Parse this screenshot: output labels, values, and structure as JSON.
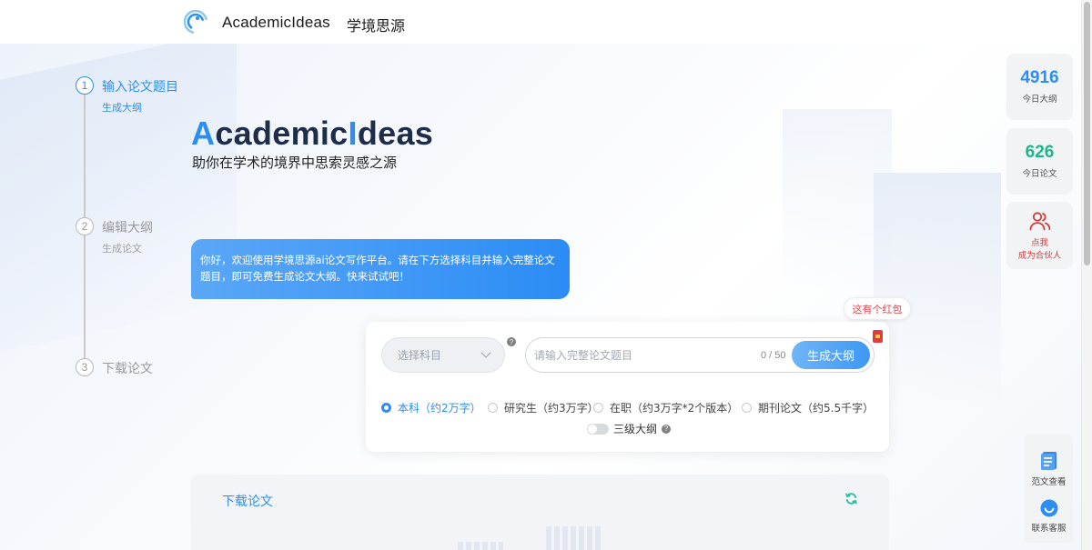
{
  "header": {
    "brand_en": "AcademicIdeas",
    "brand_cn": "学境思源",
    "logo_icon": "academicideas-logo-icon"
  },
  "steps": [
    {
      "number": "1",
      "title": "输入论文题目",
      "sub": "生成大纲",
      "active": true
    },
    {
      "number": "2",
      "title": "编辑大纲",
      "sub": "生成论文",
      "active": false
    },
    {
      "number": "3",
      "title": "下载论文",
      "sub": "",
      "active": false
    }
  ],
  "hero": {
    "title_accent_a": "A",
    "title_mid": "cademic",
    "title_accent_i": "I",
    "title_end": "deas",
    "subtitle": "助你在学术的境界中思索灵感之源"
  },
  "welcome_message": "你好，欢迎使用学境思源ai论文写作平台。请在下方选择科目并输入完整论文题目，即可免费生成论文大纲。快来试试吧！",
  "red_packet": {
    "tip": "这有个红包"
  },
  "form": {
    "subject_placeholder": "选择科目",
    "title_placeholder": "请输入完整论文题目",
    "char_count": "0 / 50",
    "generate_label": "生成大纲",
    "help": "?",
    "radios": [
      {
        "label": "本科（约2万字）",
        "checked": true
      },
      {
        "label": "研究生（约3万字）",
        "checked": false
      },
      {
        "label": "在职（约3万字*2个版本）",
        "checked": false
      },
      {
        "label": "期刊论文（约5.5千字）",
        "checked": false
      }
    ],
    "toggle_label": "三级大纲"
  },
  "download": {
    "title": "下载论文"
  },
  "stats": [
    {
      "value": "4916",
      "label": "今日大纲",
      "color": "#2d8ef0"
    },
    {
      "value": "626",
      "label": "今日论文",
      "color": "#1fb58a"
    }
  ],
  "partner": {
    "line1": "点我",
    "line2": "成为合伙人"
  },
  "tools": [
    {
      "label": "范文查看",
      "icon": "document-icon"
    },
    {
      "label": "联系客服",
      "icon": "customer-service-icon"
    }
  ],
  "colors": {
    "accent": "#2d8ef0",
    "green": "#1fb58a",
    "red": "#d23b3b"
  }
}
